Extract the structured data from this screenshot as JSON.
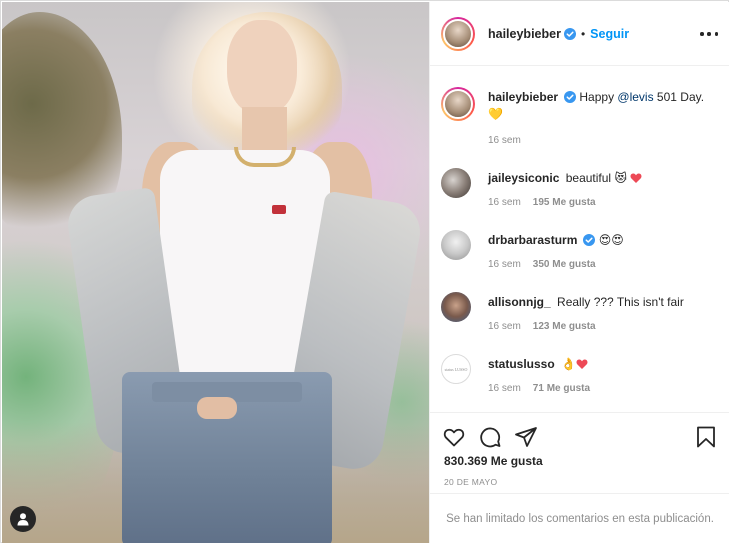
{
  "post": {
    "author": "haileybieber",
    "follow_label": "Seguir",
    "dot": "•"
  },
  "caption": {
    "username": "haileybieber",
    "text_before": "Happy ",
    "mention": "@levis",
    "text_after": " 501 Day.",
    "emoji": "💛",
    "time": "16 sem"
  },
  "comments": [
    {
      "username": "jaileysiconic",
      "text": "beautiful",
      "emoji": "😻",
      "time": "16 sem",
      "likes": "195 Me gusta",
      "verified": false
    },
    {
      "username": "drbarbarasturm",
      "text": "",
      "emoji": "😍😍",
      "time": "16 sem",
      "likes": "350 Me gusta",
      "verified": true
    },
    {
      "username": "allisonnjg_",
      "text": "Really ??? This isn't fair",
      "emoji": "",
      "time": "16 sem",
      "likes": "123 Me gusta",
      "verified": false
    },
    {
      "username": "statuslusso",
      "text": "",
      "emoji": "👌",
      "time": "16 sem",
      "likes": "71 Me gusta",
      "verified": false,
      "avatar_text": "status LUSSO"
    }
  ],
  "engagement": {
    "likes": "830.369 Me gusta",
    "date": "20 DE MAYO"
  },
  "footer": {
    "limited_text": "Se han limitado los comentarios en esta publicación."
  },
  "colors": {
    "link_blue": "#0095f6",
    "verified_blue": "#3897f0",
    "heart_red": "#ed4956",
    "muted": "#8e8e8e"
  },
  "icons": [
    "user-tag-icon",
    "verified-badge-icon",
    "more-options-icon",
    "heart-icon",
    "comment-icon",
    "share-icon",
    "bookmark-icon"
  ]
}
